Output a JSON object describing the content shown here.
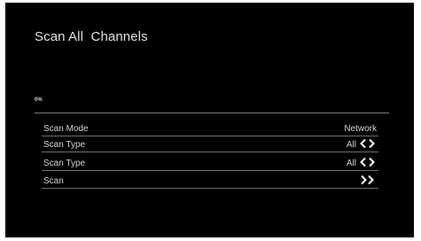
{
  "header": {
    "title": "Scan All  Channels"
  },
  "progress": {
    "text": "0%",
    "fraction": 0.0
  },
  "rows": [
    {
      "label": "Scan Mode",
      "value": "Network",
      "arrows": "none"
    },
    {
      "label": "Scan Type",
      "value": "All",
      "arrows": "left-right"
    },
    {
      "label": "Scan Type",
      "value": "All",
      "arrows": "left-right"
    },
    {
      "label": "Scan",
      "value": "",
      "arrows": "forward"
    }
  ],
  "colors": {
    "background": "#000000",
    "text": "#d4d4d4",
    "divider": "#6e6e6e"
  },
  "icons": {
    "left_right": "chevron-left-right-icon",
    "forward": "double-chevron-right-icon"
  }
}
